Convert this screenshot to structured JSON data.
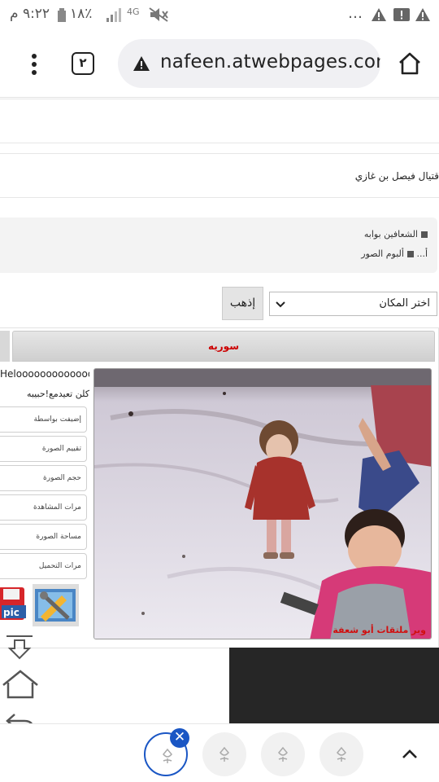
{
  "status_bar": {
    "time": "٩:٢٢ م",
    "battery_percent": "١٨٪",
    "network_type": "4G",
    "icons": [
      "battery-icon",
      "signal-icon",
      "mute-icon",
      "warning-icon",
      "notification-icon",
      "more-dots-icon"
    ]
  },
  "browser": {
    "tab_count": "٢",
    "url": "nafeen.atwebpages.com",
    "icons": [
      "menu-dots-icon",
      "tabs-icon",
      "warning-icon",
      "home-icon"
    ]
  },
  "page": {
    "header_text": "قتيال فيصل بن غازي",
    "nav_items": [
      {
        "label": "الشعافين بوابه"
      },
      {
        "label": "ألبوم الصور",
        "prefix": "أ..."
      }
    ],
    "go_button": "إذهب",
    "place_select": {
      "selected": "اختر المكان"
    },
    "category_tab": "سوريه",
    "sidebar": {
      "hello_text": "Helooooooooooooo",
      "comment": "كلن تعيدمع!حبيبه",
      "info_rows": [
        "إضيفت بواسطة",
        "تقييم الصورة",
        "حجم الصورة",
        "مرات المشاهدة",
        "مساحة الصورة",
        "مرات التحميل"
      ],
      "pic_label": "pic"
    },
    "photo_caption": "وبر ملتقات أبو شعفة"
  },
  "floating_controls": [
    "download-icon",
    "home-outline-icon",
    "back-arrow-icon",
    "edit-square-icon"
  ],
  "bottom_bar": {
    "bubbles": [
      "tulip-icon",
      "tulip-icon",
      "tulip-icon",
      "tulip-icon"
    ],
    "close_label": "✕"
  },
  "colors": {
    "accent_blue": "#1a56c4",
    "caption_red": "#d01010",
    "tab_red": "#cc0000",
    "dark_block": "#262626"
  }
}
